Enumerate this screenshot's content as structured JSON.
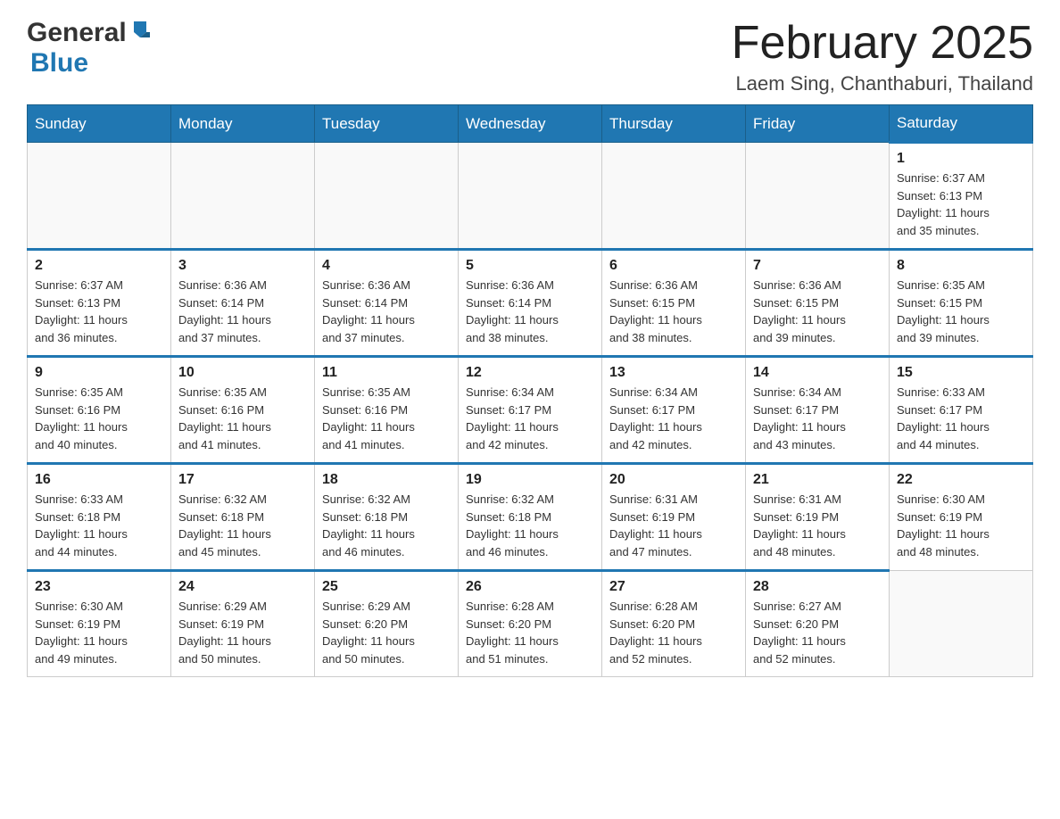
{
  "header": {
    "logo_general": "General",
    "logo_blue": "Blue",
    "month_title": "February 2025",
    "location": "Laem Sing, Chanthaburi, Thailand"
  },
  "days_of_week": [
    "Sunday",
    "Monday",
    "Tuesday",
    "Wednesday",
    "Thursday",
    "Friday",
    "Saturday"
  ],
  "weeks": [
    [
      {
        "day": "",
        "info": ""
      },
      {
        "day": "",
        "info": ""
      },
      {
        "day": "",
        "info": ""
      },
      {
        "day": "",
        "info": ""
      },
      {
        "day": "",
        "info": ""
      },
      {
        "day": "",
        "info": ""
      },
      {
        "day": "1",
        "info": "Sunrise: 6:37 AM\nSunset: 6:13 PM\nDaylight: 11 hours\nand 35 minutes."
      }
    ],
    [
      {
        "day": "2",
        "info": "Sunrise: 6:37 AM\nSunset: 6:13 PM\nDaylight: 11 hours\nand 36 minutes."
      },
      {
        "day": "3",
        "info": "Sunrise: 6:36 AM\nSunset: 6:14 PM\nDaylight: 11 hours\nand 37 minutes."
      },
      {
        "day": "4",
        "info": "Sunrise: 6:36 AM\nSunset: 6:14 PM\nDaylight: 11 hours\nand 37 minutes."
      },
      {
        "day": "5",
        "info": "Sunrise: 6:36 AM\nSunset: 6:14 PM\nDaylight: 11 hours\nand 38 minutes."
      },
      {
        "day": "6",
        "info": "Sunrise: 6:36 AM\nSunset: 6:15 PM\nDaylight: 11 hours\nand 38 minutes."
      },
      {
        "day": "7",
        "info": "Sunrise: 6:36 AM\nSunset: 6:15 PM\nDaylight: 11 hours\nand 39 minutes."
      },
      {
        "day": "8",
        "info": "Sunrise: 6:35 AM\nSunset: 6:15 PM\nDaylight: 11 hours\nand 39 minutes."
      }
    ],
    [
      {
        "day": "9",
        "info": "Sunrise: 6:35 AM\nSunset: 6:16 PM\nDaylight: 11 hours\nand 40 minutes."
      },
      {
        "day": "10",
        "info": "Sunrise: 6:35 AM\nSunset: 6:16 PM\nDaylight: 11 hours\nand 41 minutes."
      },
      {
        "day": "11",
        "info": "Sunrise: 6:35 AM\nSunset: 6:16 PM\nDaylight: 11 hours\nand 41 minutes."
      },
      {
        "day": "12",
        "info": "Sunrise: 6:34 AM\nSunset: 6:17 PM\nDaylight: 11 hours\nand 42 minutes."
      },
      {
        "day": "13",
        "info": "Sunrise: 6:34 AM\nSunset: 6:17 PM\nDaylight: 11 hours\nand 42 minutes."
      },
      {
        "day": "14",
        "info": "Sunrise: 6:34 AM\nSunset: 6:17 PM\nDaylight: 11 hours\nand 43 minutes."
      },
      {
        "day": "15",
        "info": "Sunrise: 6:33 AM\nSunset: 6:17 PM\nDaylight: 11 hours\nand 44 minutes."
      }
    ],
    [
      {
        "day": "16",
        "info": "Sunrise: 6:33 AM\nSunset: 6:18 PM\nDaylight: 11 hours\nand 44 minutes."
      },
      {
        "day": "17",
        "info": "Sunrise: 6:32 AM\nSunset: 6:18 PM\nDaylight: 11 hours\nand 45 minutes."
      },
      {
        "day": "18",
        "info": "Sunrise: 6:32 AM\nSunset: 6:18 PM\nDaylight: 11 hours\nand 46 minutes."
      },
      {
        "day": "19",
        "info": "Sunrise: 6:32 AM\nSunset: 6:18 PM\nDaylight: 11 hours\nand 46 minutes."
      },
      {
        "day": "20",
        "info": "Sunrise: 6:31 AM\nSunset: 6:19 PM\nDaylight: 11 hours\nand 47 minutes."
      },
      {
        "day": "21",
        "info": "Sunrise: 6:31 AM\nSunset: 6:19 PM\nDaylight: 11 hours\nand 48 minutes."
      },
      {
        "day": "22",
        "info": "Sunrise: 6:30 AM\nSunset: 6:19 PM\nDaylight: 11 hours\nand 48 minutes."
      }
    ],
    [
      {
        "day": "23",
        "info": "Sunrise: 6:30 AM\nSunset: 6:19 PM\nDaylight: 11 hours\nand 49 minutes."
      },
      {
        "day": "24",
        "info": "Sunrise: 6:29 AM\nSunset: 6:19 PM\nDaylight: 11 hours\nand 50 minutes."
      },
      {
        "day": "25",
        "info": "Sunrise: 6:29 AM\nSunset: 6:20 PM\nDaylight: 11 hours\nand 50 minutes."
      },
      {
        "day": "26",
        "info": "Sunrise: 6:28 AM\nSunset: 6:20 PM\nDaylight: 11 hours\nand 51 minutes."
      },
      {
        "day": "27",
        "info": "Sunrise: 6:28 AM\nSunset: 6:20 PM\nDaylight: 11 hours\nand 52 minutes."
      },
      {
        "day": "28",
        "info": "Sunrise: 6:27 AM\nSunset: 6:20 PM\nDaylight: 11 hours\nand 52 minutes."
      },
      {
        "day": "",
        "info": ""
      }
    ]
  ]
}
